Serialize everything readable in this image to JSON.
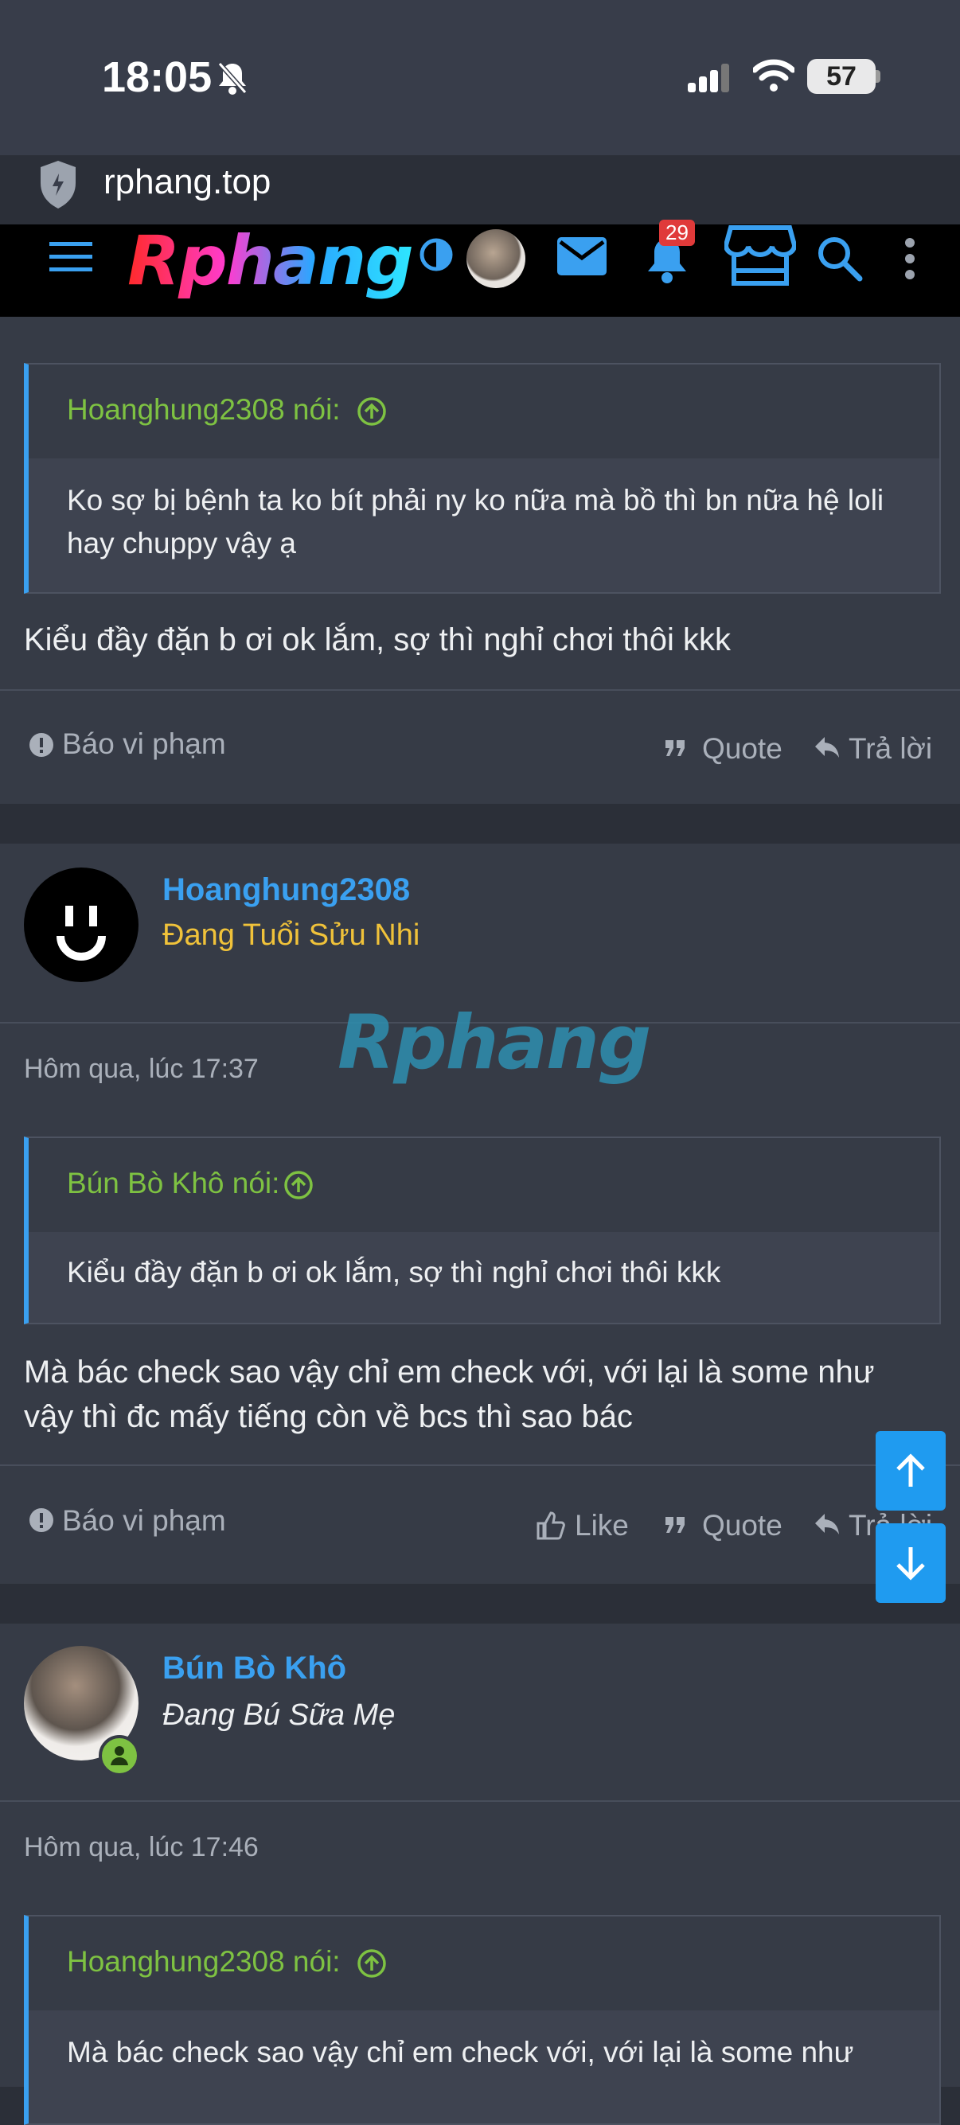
{
  "status": {
    "time": "18:05",
    "battery": "57"
  },
  "browser": {
    "url": "rphang.top"
  },
  "nav": {
    "logo": "Rphang",
    "notifications": "29"
  },
  "post1": {
    "quote_author": "Hoanghung2308 nói:",
    "quote_text": "Ko sợ bị bệnh ta ko bít phải ny ko nữa mà bồ thì bn nữa hệ loli hay chuppy vậy ạ",
    "message": "Kiểu đầy đặn b ơi ok lắm, sợ thì nghỉ chơi thôi kkk",
    "report": "Báo vi phạm",
    "quote_btn": "Quote",
    "reply_btn": "Trả lời"
  },
  "post2": {
    "username": "Hoanghung2308",
    "user_title": "Đang Tuổi Sửu Nhi",
    "date": "Hôm qua, lúc 17:37",
    "watermark": "Rphang",
    "quote_author": "Bún Bò Khô nói:",
    "quote_text": "Kiểu đầy đặn b ơi ok lắm, sợ thì nghỉ chơi thôi kkk",
    "message": "Mà bác check sao vậy chỉ em check với, với lại là some như vậy thì đc mấy tiếng còn về bcs thì sao bác",
    "report": "Báo vi phạm",
    "like_btn": "Like",
    "quote_btn": "Quote",
    "reply_btn": "Trả lời"
  },
  "post3": {
    "username": "Bún Bò Khô",
    "user_title": "Đang Bú Sữa Mẹ",
    "date": "Hôm qua, lúc 17:46",
    "quote_author": "Hoanghung2308 nói:",
    "quote_text": "Mà bác check sao vậy chỉ em check với, với lại là some như"
  },
  "colors": {
    "accent": "#3aa0f0",
    "quote_author": "#7ec242",
    "title_gold": "#f0c23a"
  }
}
